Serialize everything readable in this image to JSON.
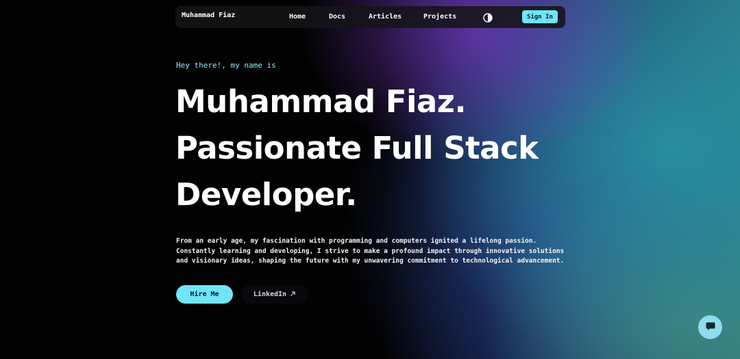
{
  "nav": {
    "brand": "Muhammad Fiaz",
    "links": [
      "Home",
      "Docs",
      "Articles",
      "Projects"
    ],
    "theme_toggle_icon": "half-circle-contrast-icon",
    "signin_label": "Sign In"
  },
  "hero": {
    "greeting": "Hey there!, my name is",
    "headline": [
      "Muhammad Fiaz.",
      "Passionate Full Stack",
      "Developer."
    ],
    "intro": "From an early age, my fascination with programming and computers ignited a lifelong passion. Constantly learning and developing, I strive to make a profound impact through innovative solutions and visionary ideas, shaping the future with my unwavering commitment to technological advancement.",
    "hire_label": "Hire Me",
    "linkedin_label": "LinkedIn",
    "linkedin_icon": "arrow-up-right-icon"
  },
  "chat": {
    "icon": "chat-bubble-icon"
  },
  "colors": {
    "accent": "#6fe5f5",
    "background": "#020203",
    "greeting": "#8fe9f4"
  }
}
